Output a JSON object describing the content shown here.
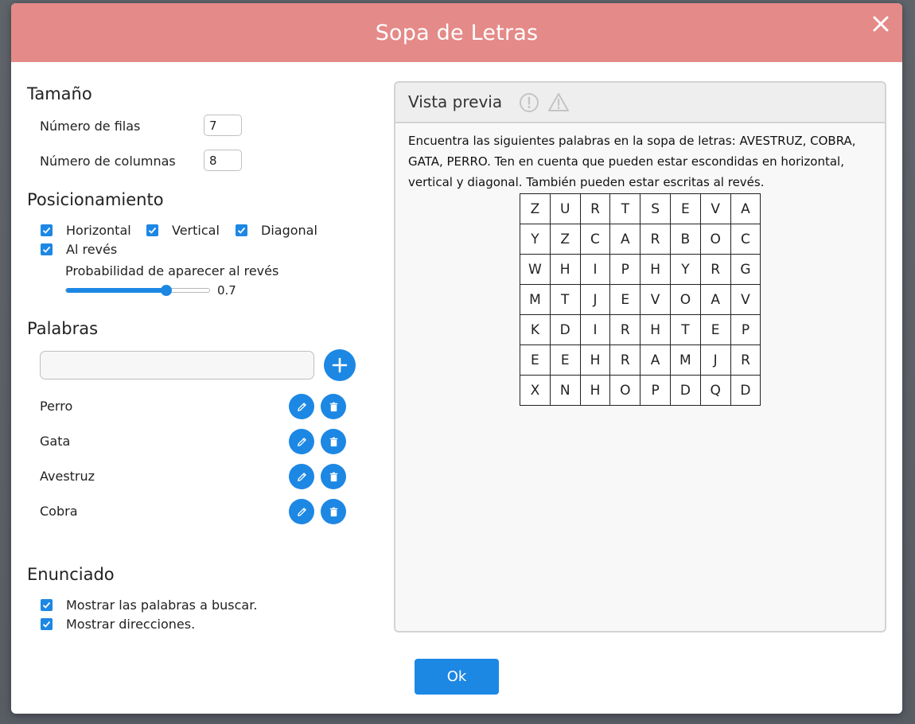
{
  "dialog": {
    "title": "Sopa de Letras",
    "close_icon": "close-icon",
    "ok_label": "Ok"
  },
  "size": {
    "title": "Tamaño",
    "rows_label": "Número de filas",
    "rows_value": "7",
    "cols_label": "Número de columnas",
    "cols_value": "8"
  },
  "positioning": {
    "title": "Posicionamiento",
    "horizontal": {
      "label": "Horizontal",
      "checked": true
    },
    "vertical": {
      "label": "Vertical",
      "checked": true
    },
    "diagonal": {
      "label": "Diagonal",
      "checked": true
    },
    "reverse": {
      "label": "Al revés",
      "checked": true
    },
    "probability_label": "Probabilidad de aparecer al revés",
    "probability_value": 0.7,
    "probability_text": "0.7"
  },
  "words": {
    "title": "Palabras",
    "input_value": "",
    "add_icon": "plus-icon",
    "items": [
      {
        "label": "Perro"
      },
      {
        "label": "Gata"
      },
      {
        "label": "Avestruz"
      },
      {
        "label": "Cobra"
      }
    ],
    "edit_icon": "pencil-icon",
    "delete_icon": "trash-icon"
  },
  "statement": {
    "title": "Enunciado",
    "show_words": {
      "label": "Mostrar las palabras a buscar.",
      "checked": true
    },
    "show_directions": {
      "label": "Mostrar direcciones.",
      "checked": true
    }
  },
  "preview": {
    "title": "Vista previa",
    "icons": [
      "info-circle-icon",
      "warning-triangle-icon"
    ],
    "instructions": "Encuentra las siguientes palabras en la sopa de letras: AVESTRUZ, COBRA, GATA, PERRO. Ten en cuenta que pueden estar escondidas en horizontal, vertical y diagonal. También pueden estar escritas al revés.",
    "grid": [
      [
        "Z",
        "U",
        "R",
        "T",
        "S",
        "E",
        "V",
        "A"
      ],
      [
        "Y",
        "Z",
        "C",
        "A",
        "R",
        "B",
        "O",
        "C"
      ],
      [
        "W",
        "H",
        "I",
        "P",
        "H",
        "Y",
        "R",
        "G"
      ],
      [
        "M",
        "T",
        "J",
        "E",
        "V",
        "O",
        "A",
        "V"
      ],
      [
        "K",
        "D",
        "I",
        "R",
        "H",
        "T",
        "E",
        "P"
      ],
      [
        "E",
        "E",
        "H",
        "R",
        "A",
        "M",
        "J",
        "R"
      ],
      [
        "X",
        "N",
        "H",
        "O",
        "P",
        "D",
        "Q",
        "D"
      ]
    ]
  },
  "colors": {
    "header": "#e48a88",
    "accent": "#1d87e4"
  }
}
